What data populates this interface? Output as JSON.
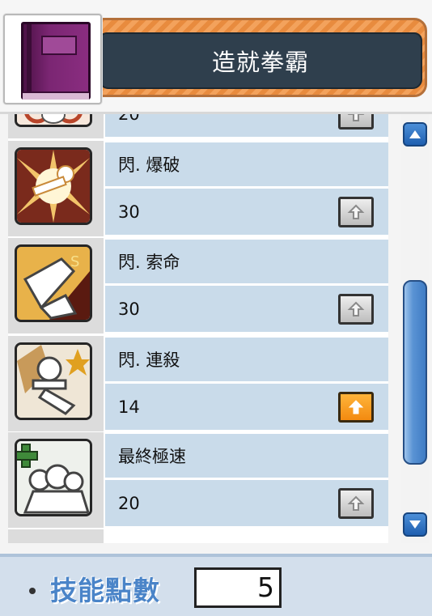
{
  "header": {
    "title": "造就拳霸",
    "book_icon": "skill-book-icon"
  },
  "skills": [
    {
      "name": "",
      "level": "20",
      "icon": "partial-skill-icon",
      "can_raise": false
    },
    {
      "name": "閃. 爆破",
      "level": "30",
      "icon": "explosion-skill-icon",
      "can_raise": false
    },
    {
      "name": "閃. 索命",
      "level": "30",
      "icon": "slash-skill-icon",
      "can_raise": false
    },
    {
      "name": "閃. 連殺",
      "level": "14",
      "icon": "combo-kill-skill-icon",
      "can_raise": true
    },
    {
      "name": "最終極速",
      "level": "20",
      "icon": "speed-buff-skill-icon",
      "can_raise": false
    }
  ],
  "scroll": {
    "position_fraction": 0.5
  },
  "footer": {
    "sp_label": "技能點數",
    "sp_value": "5"
  },
  "colors": {
    "row_bg": "#c9dbea",
    "banner_orange": "#e88b3e",
    "banner_dark": "#2f3f4d",
    "active_button": "#f38a10",
    "scroll_blue": "#3f7cc4"
  }
}
